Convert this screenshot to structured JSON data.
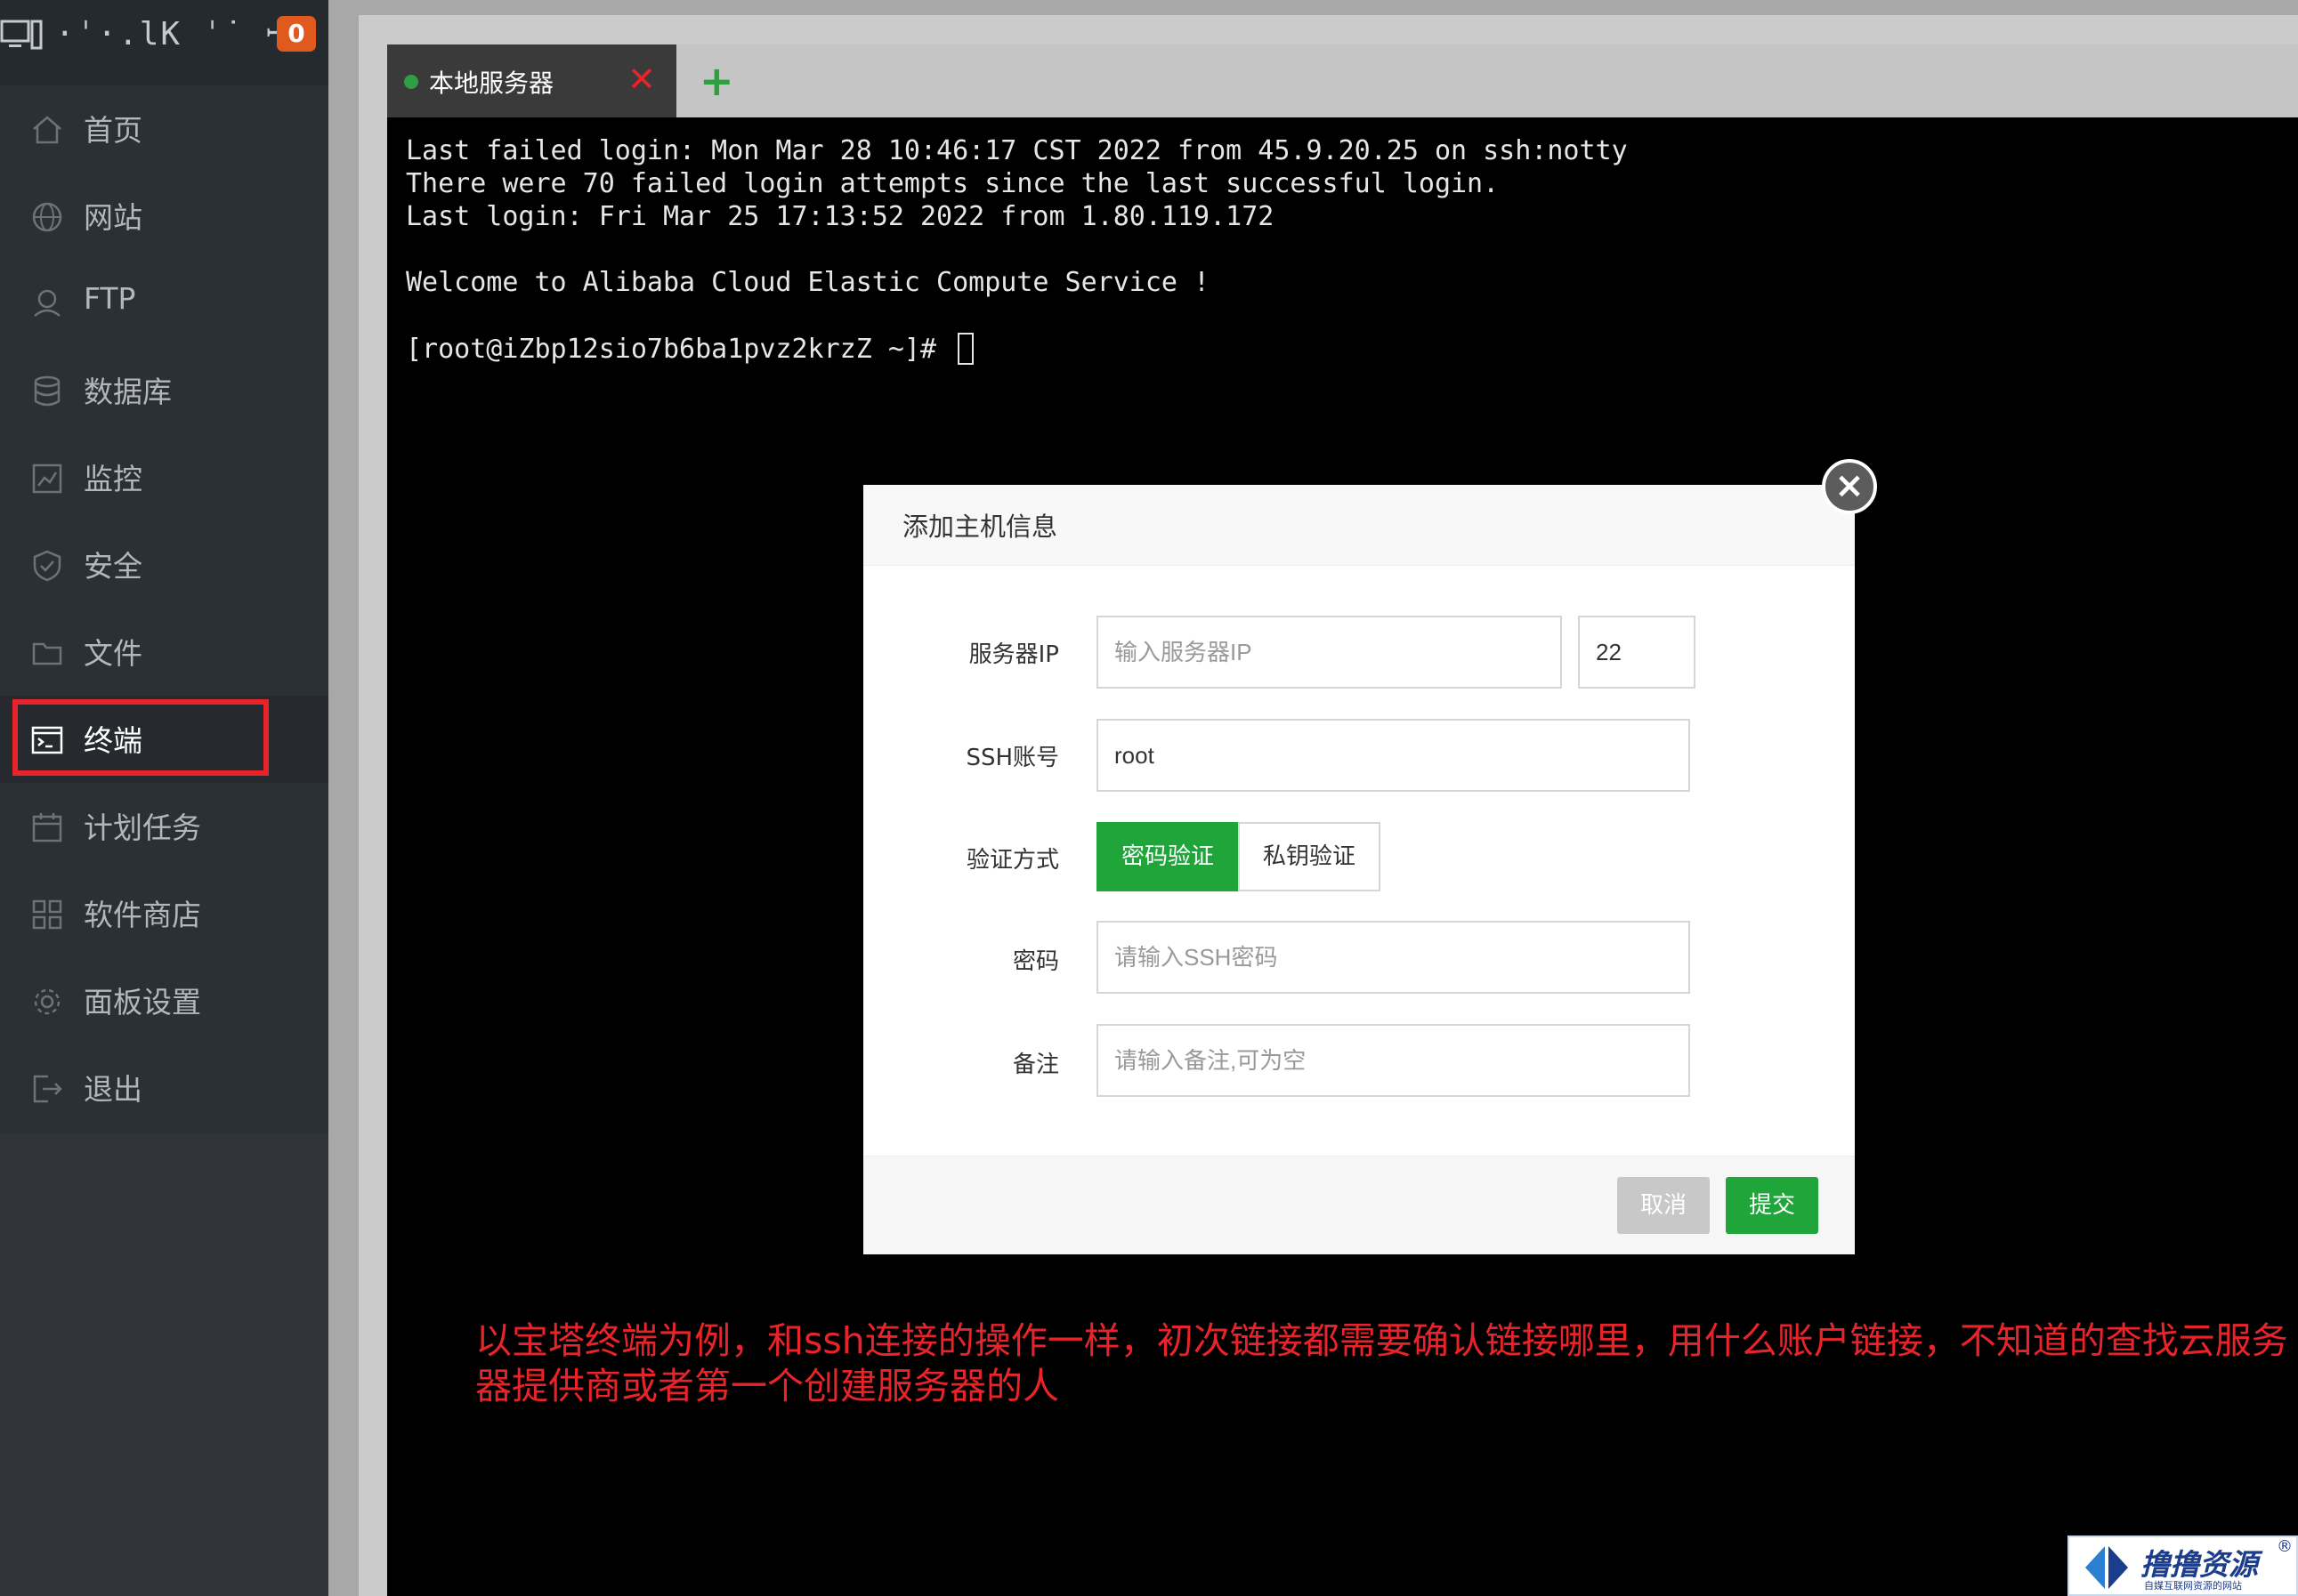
{
  "sidebar": {
    "host_name": "·ˈ·.lK ˈ˙ ꟷ2",
    "badge_count": "0",
    "items": [
      {
        "label": "首页",
        "icon": "home-icon"
      },
      {
        "label": "网站",
        "icon": "globe-icon"
      },
      {
        "label": "FTP",
        "icon": "ftp-icon"
      },
      {
        "label": "数据库",
        "icon": "database-icon"
      },
      {
        "label": "监控",
        "icon": "monitor-chart-icon"
      },
      {
        "label": "安全",
        "icon": "shield-icon"
      },
      {
        "label": "文件",
        "icon": "folder-icon"
      },
      {
        "label": "终端",
        "icon": "terminal-icon",
        "active": true
      },
      {
        "label": "计划任务",
        "icon": "calendar-icon"
      },
      {
        "label": "软件商店",
        "icon": "apps-grid-icon"
      },
      {
        "label": "面板设置",
        "icon": "gear-icon"
      },
      {
        "label": "退出",
        "icon": "logout-icon"
      }
    ]
  },
  "tabs": {
    "items": [
      {
        "label": "本地服务器",
        "status_color": "#2f9e44"
      }
    ],
    "close_symbol": "✕",
    "add_symbol": "+"
  },
  "terminal": {
    "lines": [
      "Last failed login: Mon Mar 28 10:46:17 CST 2022 from 45.9.20.25 on ssh:notty",
      "There were 70 failed login attempts since the last successful login.",
      "Last login: Fri Mar 25 17:13:52 2022 from 1.80.119.172",
      "",
      "Welcome to Alibaba Cloud Elastic Compute Service !",
      "",
      "[root@iZbp12sio7b6ba1pvz2krzZ ~]# "
    ]
  },
  "modal": {
    "title": "添加主机信息",
    "fields": {
      "server_ip": {
        "label": "服务器IP",
        "placeholder": "输入服务器IP",
        "value": ""
      },
      "port": {
        "value": "22"
      },
      "ssh_account": {
        "label": "SSH账号",
        "value": "root"
      },
      "auth_method": {
        "label": "验证方式",
        "options": [
          "密码验证",
          "私钥验证"
        ],
        "selected": "密码验证"
      },
      "password": {
        "label": "密码",
        "placeholder": "请输入SSH密码"
      },
      "note": {
        "label": "备注",
        "placeholder": "请输入备注,可为空"
      }
    },
    "cancel_label": "取消",
    "submit_label": "提交"
  },
  "annotation": {
    "text": "以宝塔终端为例，和ssh连接的操作一样，初次链接都需要确认链接哪里，用什么账户链接，不知道的查找云服务器提供商或者第一个创建服务器的人"
  },
  "watermark": {
    "title": "撸撸资源",
    "subtitle": "自媒互联网资源的网站",
    "registered": "®"
  },
  "colors": {
    "accent_green": "#20a53a",
    "highlight_red": "#e8242a",
    "badge_orange": "#e05a1e",
    "sidebar_bg": "#2e3338",
    "terminal_bg": "#000000"
  }
}
